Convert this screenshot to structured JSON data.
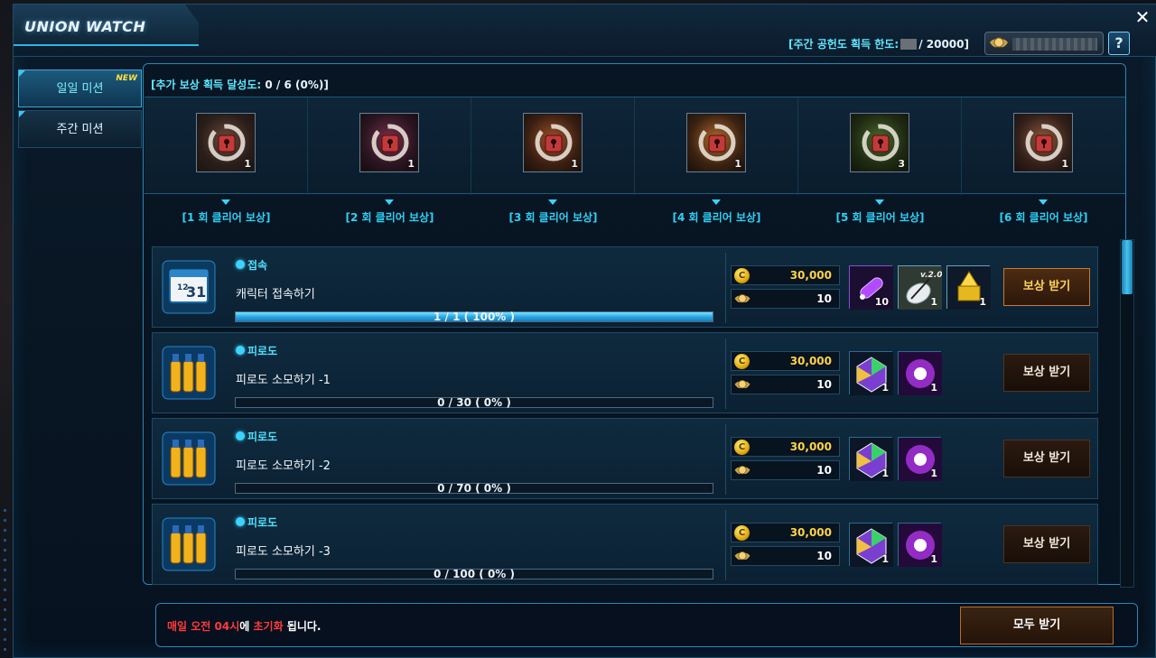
{
  "window": {
    "title": "UNION WATCH",
    "close_glyph": "✕"
  },
  "header": {
    "contrib_limit_label": "[주간 공헌도 획득 한도:",
    "contrib_limit_max": "/ 20000]",
    "help_glyph": "?"
  },
  "sidebar": {
    "tabs": [
      {
        "label": "일일 미션",
        "badge": "NEW"
      },
      {
        "label": "주간 미션"
      }
    ]
  },
  "bonus": {
    "progress_label": "[추가 보상 획득 달성도:",
    "progress_value": "0 / 6 (0%)]",
    "rewards": [
      {
        "qty": "1",
        "label": "[1 회 클리어 보상]"
      },
      {
        "qty": "1",
        "label": "[2 회 클리어 보상]"
      },
      {
        "qty": "1",
        "label": "[3 회 클리어 보상]"
      },
      {
        "qty": "1",
        "label": "[4 회 클리어 보상]"
      },
      {
        "qty": "3",
        "label": "[5 회 클리어 보상]"
      },
      {
        "qty": "1",
        "label": "[6 회 클리어 보상]"
      }
    ]
  },
  "missions": [
    {
      "category": "접속",
      "name": "캐릭터 접속하기",
      "progress_text": "1 / 1 ( 100% )",
      "progress_fraction": 1.0,
      "gold": "30,000",
      "contrib": "10",
      "items": [
        {
          "qty": "10"
        },
        {
          "qty": "1"
        },
        {
          "qty": "1"
        }
      ],
      "claim_label": "보상 받기"
    },
    {
      "category": "피로도",
      "name": "피로도 소모하기 -1",
      "progress_text": "0 / 30 ( 0% )",
      "progress_fraction": 0,
      "gold": "30,000",
      "contrib": "10",
      "items": [
        {
          "qty": "1"
        },
        {
          "qty": "1"
        }
      ],
      "claim_label": "보상 받기"
    },
    {
      "category": "피로도",
      "name": "피로도 소모하기 -2",
      "progress_text": "0 / 70 ( 0% )",
      "progress_fraction": 0,
      "gold": "30,000",
      "contrib": "10",
      "items": [
        {
          "qty": "1"
        },
        {
          "qty": "1"
        }
      ],
      "claim_label": "보상 받기"
    },
    {
      "category": "피로도",
      "name": "피로도 소모하기 -3",
      "progress_text": "0 / 100 ( 0% )",
      "progress_fraction": 0,
      "gold": "30,000",
      "contrib": "10",
      "items": [
        {
          "qty": "1"
        },
        {
          "qty": "1"
        }
      ],
      "claim_label": "보상 받기"
    }
  ],
  "footer": {
    "notice_part1": "매일 오전 04시",
    "notice_part2": "에 ",
    "notice_part3": "초기화",
    "notice_part4": " 됩니다.",
    "claim_all_label": "모두 받기"
  },
  "colors": {
    "accent_cyan": "#3ed2ff",
    "gold_text": "#ffd24a",
    "notice_red": "#ff3a3a",
    "claim_ready_border": "#c97b2a"
  },
  "icons": {
    "gold": "gold-coin-icon",
    "contrib": "union-contribution-icon",
    "calendar": "calendar-icon",
    "fatigue": "fatigue-potion-icon"
  }
}
